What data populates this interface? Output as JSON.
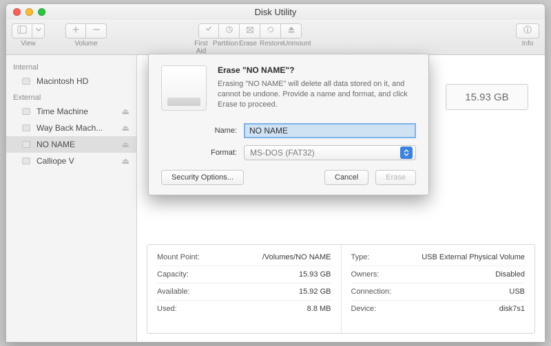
{
  "window": {
    "title": "Disk Utility"
  },
  "toolbar": {
    "view": "View",
    "volume": "Volume",
    "first_aid": "First Aid",
    "partition": "Partition",
    "erase": "Erase",
    "restore": "Restore",
    "unmount": "Unmount",
    "info": "Info"
  },
  "sidebar": {
    "internal_header": "Internal",
    "external_header": "External",
    "internal": [
      {
        "label": "Macintosh HD"
      }
    ],
    "external": [
      {
        "label": "Time Machine"
      },
      {
        "label": "Way Back Mach..."
      },
      {
        "label": "NO NAME",
        "selected": true
      },
      {
        "label": "Calliope V"
      }
    ]
  },
  "summary": {
    "capacity_box": "15.93 GB"
  },
  "info": {
    "left": {
      "mount_point_label": "Mount Point:",
      "mount_point_value": "/Volumes/NO NAME",
      "capacity_label": "Capacity:",
      "capacity_value": "15.93 GB",
      "available_label": "Available:",
      "available_value": "15.92 GB",
      "used_label": "Used:",
      "used_value": "8.8 MB"
    },
    "right": {
      "type_label": "Type:",
      "type_value": "USB External Physical Volume",
      "owners_label": "Owners:",
      "owners_value": "Disabled",
      "connection_label": "Connection:",
      "connection_value": "USB",
      "device_label": "Device:",
      "device_value": "disk7s1"
    }
  },
  "sheet": {
    "title": "Erase \"NO NAME\"?",
    "description": "Erasing \"NO NAME\" will delete all data stored on it, and cannot be undone. Provide a name and format, and click Erase to proceed.",
    "name_label": "Name:",
    "name_value": "NO NAME",
    "format_label": "Format:",
    "format_value": "MS-DOS (FAT32)",
    "security_options": "Security Options...",
    "cancel": "Cancel",
    "erase": "Erase"
  }
}
